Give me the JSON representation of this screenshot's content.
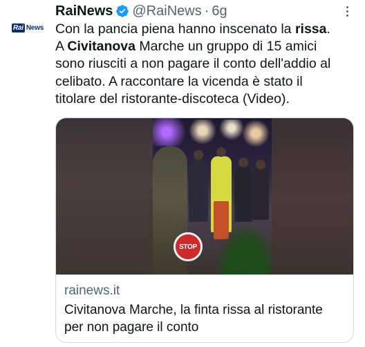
{
  "account": {
    "avatar_text_a": "Rai",
    "avatar_text_b": "News",
    "name": "RaiNews",
    "handle": "@RaiNews",
    "separator": "·",
    "time": "6g"
  },
  "tweet": {
    "seg1": "Con la pancia piena hanno inscenato la ",
    "seg2_bold": "rissa",
    "seg3": ".",
    "seg4": "A ",
    "seg5_bold": "Civitanova",
    "seg6": " Marche un gruppo di 15 amici",
    "line3": "sono riusciti a non pagare il conto dell'addio al",
    "line4": "celibato. A raccontare la vicenda è stato il",
    "line5": "titolare del ristorante-discoteca (Video)."
  },
  "card": {
    "domain": "rainews.it",
    "title": "Civitanova Marche, la finta rissa al ristorante per non pagare il conto",
    "stop_sign_text": "STOP"
  },
  "icons": {
    "verified": "verified-badge-icon",
    "more": "more-options-icon"
  },
  "colors": {
    "text": "#0f1419",
    "secondary": "#536471",
    "verified_blue": "#1d9bf0",
    "border": "#cfd9de",
    "rai_blue": "#0a2e6e"
  }
}
